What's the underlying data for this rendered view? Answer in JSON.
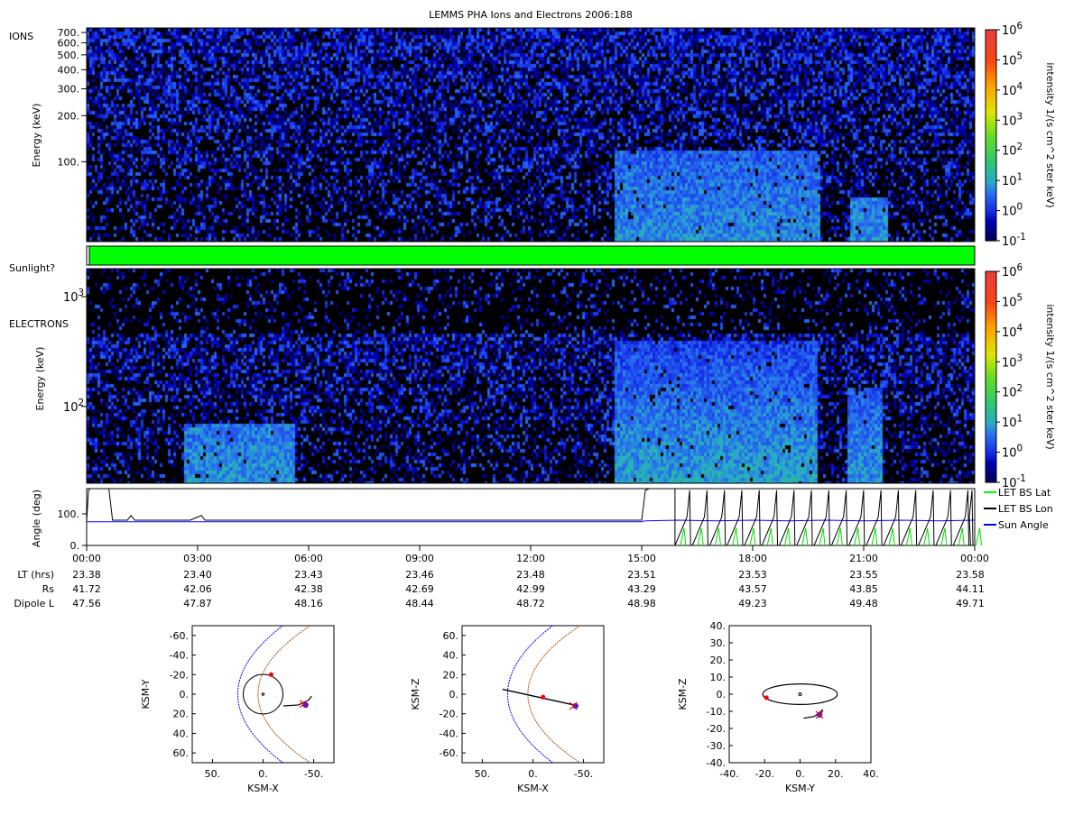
{
  "title": "LEMMS PHA Ions and Electrons  2006:188",
  "colorbar": {
    "label": "intensity 1/(s cm^2 ster keV)",
    "ticks": [
      "10",
      "10",
      "10",
      "10",
      "10",
      "10",
      "10",
      "10"
    ],
    "exponents": [
      "6",
      "5",
      "4",
      "3",
      "2",
      "1",
      "0",
      "-1"
    ]
  },
  "ions": {
    "label": "IONS",
    "ylabel": "Energy (keV)",
    "yticks": [
      "700.",
      "600.",
      "500.",
      "400.",
      "300.",
      "200.",
      "100."
    ]
  },
  "sunlight": {
    "label": "Sunlight?"
  },
  "electrons": {
    "label": "ELECTRONS",
    "ylabel": "Energy (keV)",
    "yticks": [
      {
        "base": "10",
        "exp": "3"
      },
      {
        "base": "10",
        "exp": "2"
      }
    ]
  },
  "angle": {
    "ylabel": "Angle (deg)",
    "yticks": [
      "100.",
      "0."
    ],
    "legend": [
      "LET BS Lat",
      "LET BS Lon",
      "Sun Angle"
    ],
    "legend_colors": [
      "#00ff00",
      "#000000",
      "#0000ff"
    ]
  },
  "time_axis": {
    "ticks": [
      "00:00",
      "03:00",
      "06:00",
      "09:00",
      "12:00",
      "15:00",
      "18:00",
      "21:00",
      "00:00"
    ],
    "rows": [
      {
        "label": "LT (hrs)",
        "values": [
          "23.38",
          "23.40",
          "23.43",
          "23.46",
          "23.48",
          "23.51",
          "23.53",
          "23.55",
          "23.58"
        ]
      },
      {
        "label": "Rs",
        "values": [
          "41.72",
          "42.06",
          "42.38",
          "42.69",
          "42.99",
          "43.29",
          "43.57",
          "43.85",
          "44.11"
        ]
      },
      {
        "label": "Dipole L",
        "values": [
          "47.56",
          "47.87",
          "48.16",
          "48.44",
          "48.72",
          "48.98",
          "49.23",
          "49.48",
          "49.71"
        ]
      }
    ]
  },
  "orbit_panels": [
    {
      "xlabel": "KSM-X",
      "ylabel": "KSM-Y",
      "xticks": [
        "50.",
        "0.",
        "-50."
      ],
      "yticks": [
        "-60.",
        "-40.",
        "-20.",
        "0.",
        "20.",
        "40.",
        "60."
      ]
    },
    {
      "xlabel": "KSM-X",
      "ylabel": "KSM-Z",
      "xticks": [
        "50.",
        "0.",
        "-50."
      ],
      "yticks": [
        "60.",
        "40.",
        "20.",
        "0.",
        "-20.",
        "-40.",
        "-60."
      ]
    },
    {
      "xlabel": "KSM-Y",
      "ylabel": "KSM-Z",
      "xticks": [
        "-40.",
        "-20.",
        "0.",
        "20.",
        "40."
      ],
      "yticks": [
        "40.",
        "30.",
        "20.",
        "10.",
        "0.",
        "-10.",
        "-20.",
        "-30.",
        "-40."
      ]
    }
  ],
  "chart_data": [
    {
      "type": "heatmap",
      "name": "ions",
      "x_range": [
        "00:00",
        "24:00"
      ],
      "y_scale": "log",
      "ylim": [
        30,
        750
      ],
      "bursts": [
        {
          "start_hr": 14.2,
          "end_hr": 19.8,
          "energy_keV": [
            30,
            120
          ],
          "level_log10": 0.8
        },
        {
          "start_hr": 20.6,
          "end_hr": 21.6,
          "energy_keV": [
            30,
            60
          ],
          "level_log10": 0.8
        }
      ],
      "background_level_log10": 0.0
    },
    {
      "type": "heatmap",
      "name": "electrons",
      "x_range": [
        "00:00",
        "24:00"
      ],
      "y_scale": "log",
      "ylim": [
        20,
        1800
      ],
      "bursts": [
        {
          "start_hr": 2.6,
          "end_hr": 5.6,
          "energy_keV": [
            20,
            70
          ],
          "level_log10": 0.9
        },
        {
          "start_hr": 14.2,
          "end_hr": 19.7,
          "energy_keV": [
            20,
            400
          ],
          "level_log10": 1.0
        },
        {
          "start_hr": 20.5,
          "end_hr": 21.5,
          "energy_keV": [
            20,
            150
          ],
          "level_log10": 0.9
        }
      ],
      "background_level_log10": 0.0
    },
    {
      "type": "line",
      "name": "angles",
      "ylim": [
        0,
        180
      ],
      "series": [
        {
          "name": "LET BS Lon",
          "x": [
            0,
            0.05,
            0.1,
            0.6,
            0.7,
            1.1,
            1.2,
            1.3,
            2.8,
            3.0,
            3.1,
            3.2,
            15.0,
            15.1,
            15.2,
            15.9,
            15.9
          ],
          "y": [
            75,
            175,
            180,
            180,
            80,
            80,
            95,
            80,
            80,
            90,
            95,
            80,
            80,
            175,
            180,
            180,
            0
          ]
        },
        {
          "name": "Sun Angle",
          "x": [
            0,
            15.0,
            15.1,
            16,
            17,
            18,
            19,
            20,
            21,
            22,
            23,
            24
          ],
          "y": [
            75,
            75,
            78,
            80,
            78,
            80,
            78,
            80,
            78,
            80,
            78,
            80
          ]
        }
      ],
      "oscillation": {
        "start_hr": 15.9,
        "end_hr": 24.0,
        "period_hr": 0.47,
        "lon_peak": 175,
        "lat_peak": 55
      }
    },
    {
      "type": "line",
      "name": "sunlight",
      "x": [
        0,
        24
      ],
      "y": [
        1,
        1
      ]
    },
    {
      "type": "scatter",
      "name": "orbit-xy",
      "xlim": [
        70,
        -70
      ],
      "ylim": [
        -70,
        70
      ],
      "planet_center": [
        0,
        0
      ],
      "orbit": [
        [
          5,
          -12
        ],
        [
          0,
          -18
        ],
        [
          -8,
          -20
        ],
        [
          -15,
          -15
        ],
        [
          -18,
          -5
        ],
        [
          -15,
          8
        ],
        [
          -8,
          14
        ],
        [
          0,
          16
        ],
        [
          8,
          13
        ],
        [
          15,
          5
        ],
        [
          18,
          -5
        ],
        [
          14,
          -15
        ],
        [
          5,
          -18
        ],
        [
          -8,
          12
        ],
        [
          -30,
          12
        ],
        [
          -40,
          10
        ],
        [
          -45,
          5
        ]
      ],
      "markers": {
        "red_dot": [
          -8,
          -20
        ],
        "red_x": [
          -40,
          10
        ],
        "blue_dot": [
          -42,
          11
        ]
      }
    },
    {
      "type": "scatter",
      "name": "orbit-xz",
      "xlim": [
        70,
        -70
      ],
      "ylim": [
        -70,
        70
      ],
      "orbit": [
        [
          30,
          5
        ],
        [
          -10,
          -3
        ],
        [
          -45,
          -12
        ]
      ],
      "markers": {
        "red_dot": [
          -10,
          -3
        ],
        "red_x": [
          -40,
          -12
        ],
        "blue_dot": [
          -42,
          -12
        ]
      }
    },
    {
      "type": "scatter",
      "name": "orbit-yz",
      "xlim": [
        -40,
        40
      ],
      "ylim": [
        -40,
        40
      ],
      "orbit_ellipse": {
        "center": [
          0,
          0
        ],
        "rx": 21,
        "ry": 6
      },
      "markers": {
        "red_dot": [
          -19,
          -2
        ],
        "red_x": [
          11,
          -12
        ],
        "blue_dot": [
          11,
          -12
        ]
      }
    }
  ]
}
